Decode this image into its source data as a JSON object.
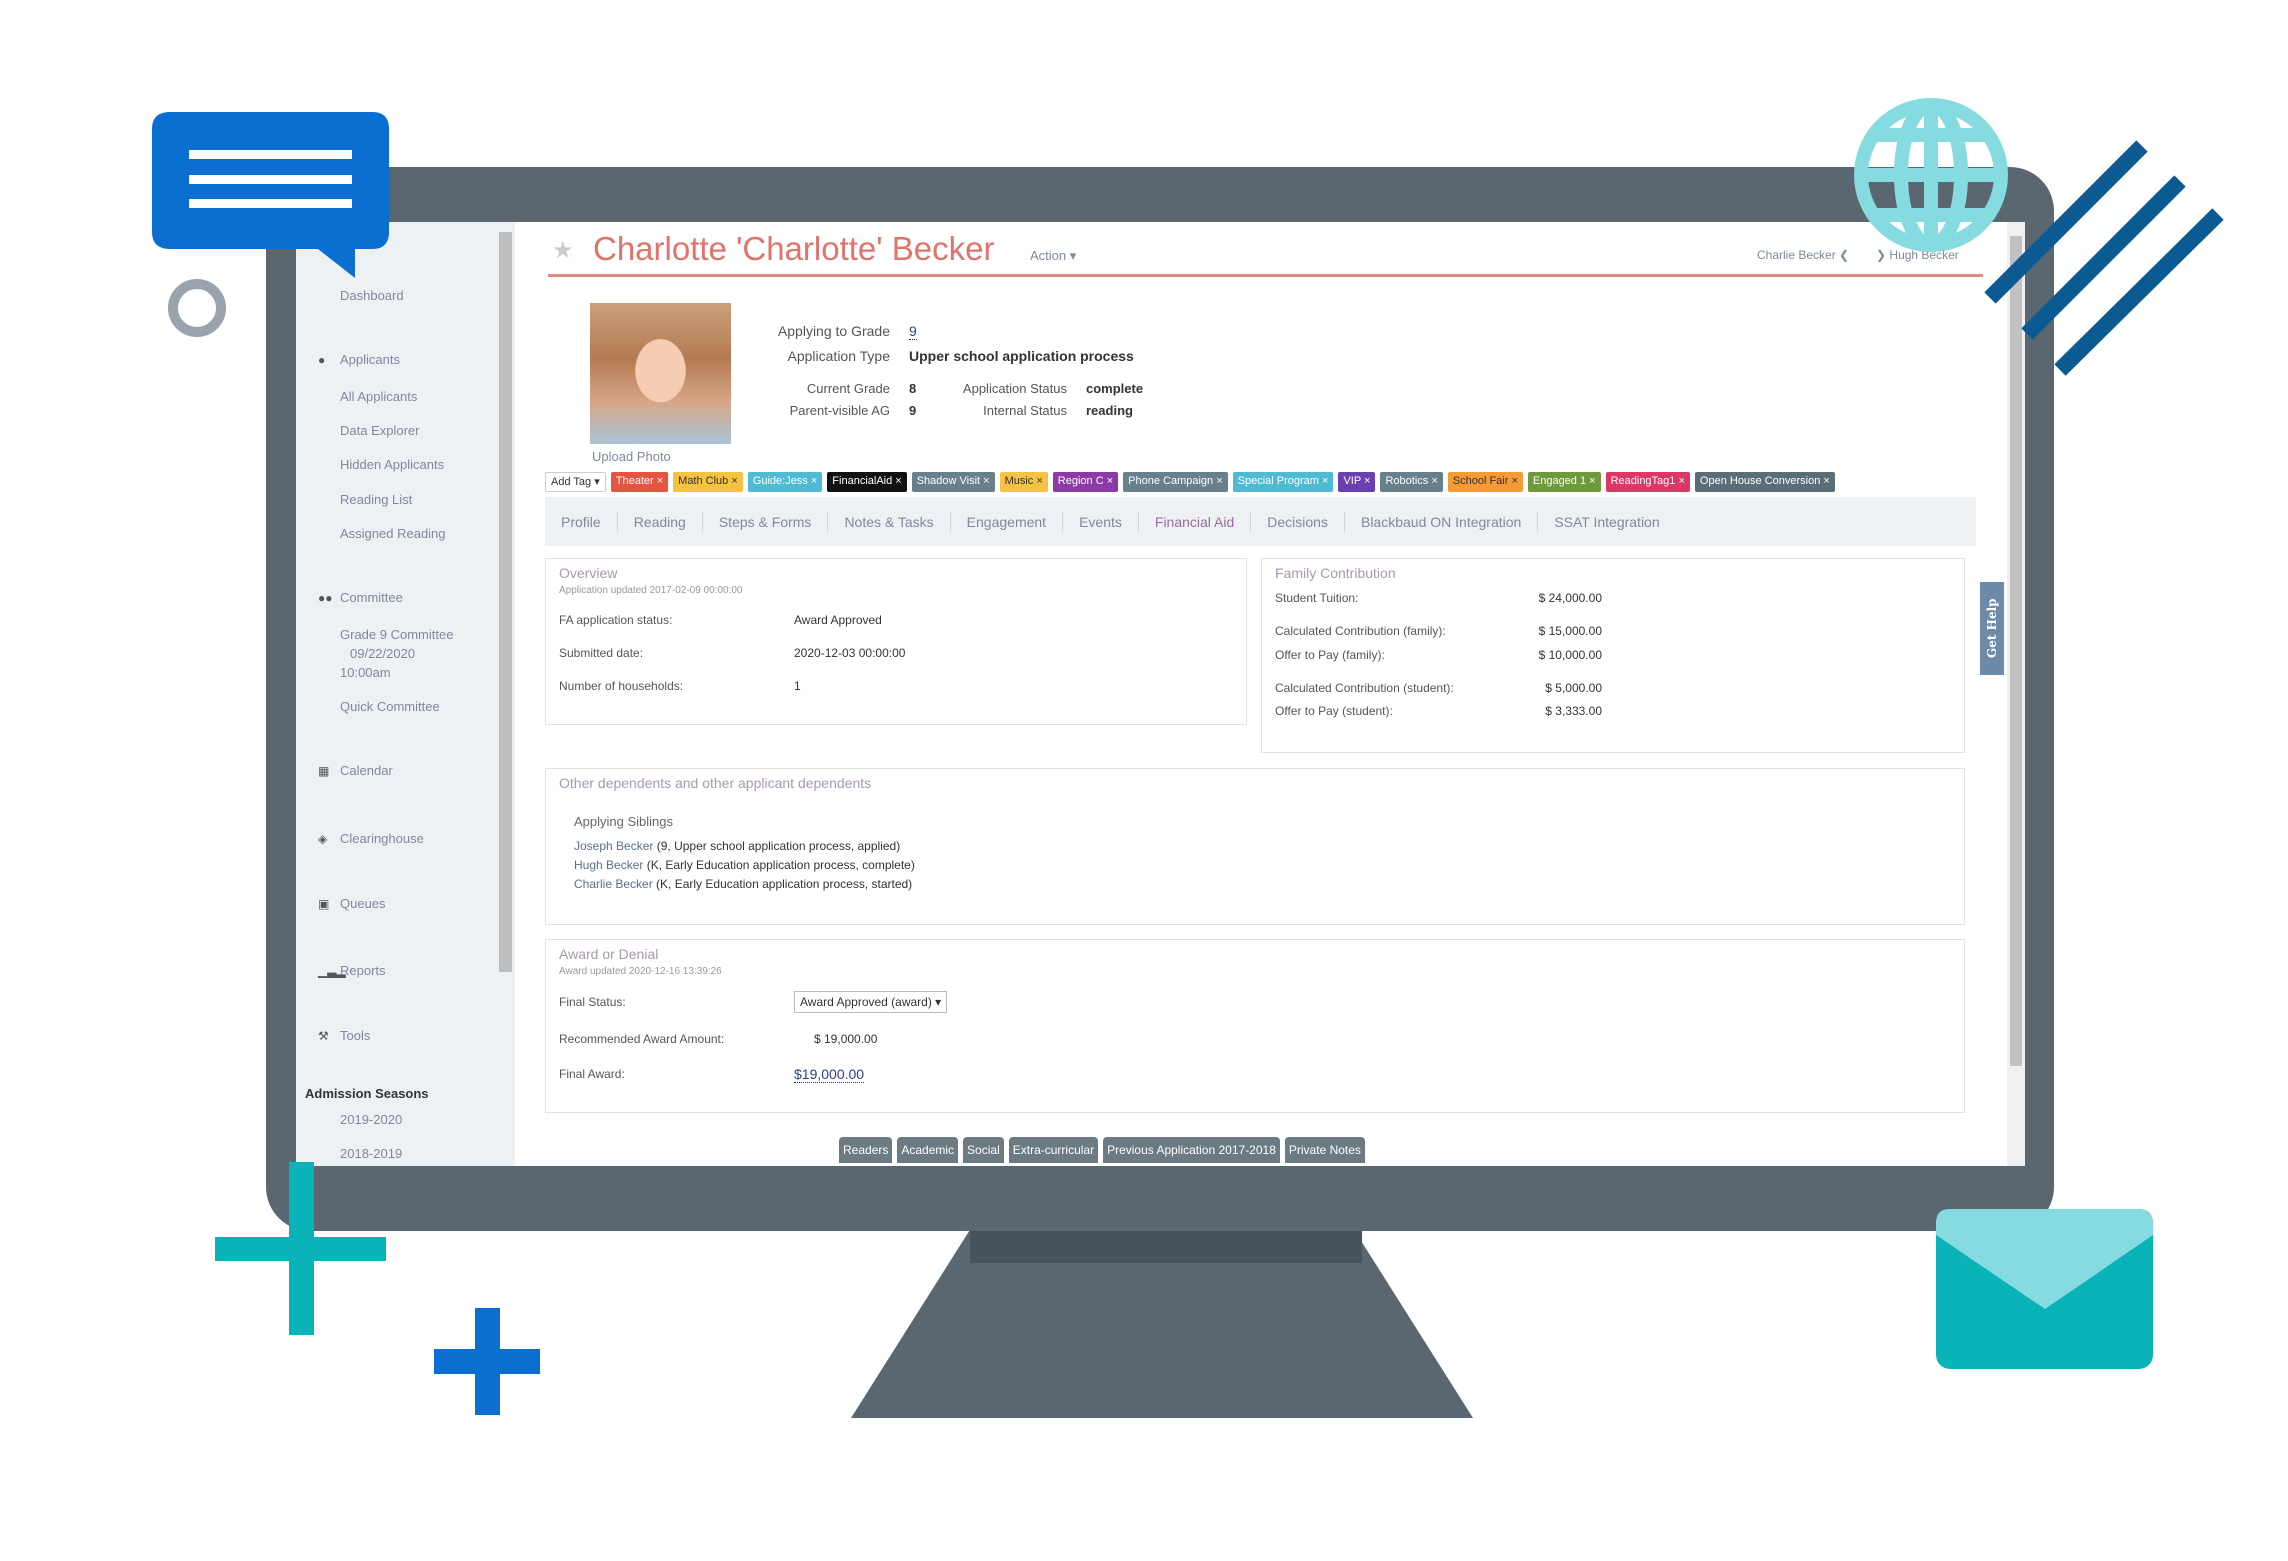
{
  "header": {
    "applicant_name": "Charlotte 'Charlotte' Becker",
    "action_label": "Action ▾",
    "prev_applicant": "Charlie Becker",
    "next_applicant": "Hugh Becker",
    "upload_photo": "Upload Photo"
  },
  "summary": {
    "applying_grade_label": "Applying to Grade",
    "applying_grade": "9",
    "app_type_label": "Application Type",
    "app_type": "Upper school application process",
    "current_grade_label": "Current Grade",
    "current_grade": "8",
    "parent_ag_label": "Parent-visible AG",
    "parent_ag": "9",
    "app_status_label": "Application Status",
    "app_status": "complete",
    "internal_status_label": "Internal Status",
    "internal_status": "reading"
  },
  "add_tag_label": "Add Tag ▾",
  "tags": [
    {
      "label": "Theater",
      "color": "#e45541",
      "text": "#fff"
    },
    {
      "label": "Math Club",
      "color": "#f5c242",
      "text": "#333"
    },
    {
      "label": "Guide:Jess",
      "color": "#4fbad3",
      "text": "#fff"
    },
    {
      "label": "FinancialAid",
      "color": "#111111",
      "text": "#fff"
    },
    {
      "label": "Shadow Visit",
      "color": "#67808c",
      "text": "#fff"
    },
    {
      "label": "Music",
      "color": "#f5c242",
      "text": "#333"
    },
    {
      "label": "Region C",
      "color": "#8e3aa6",
      "text": "#fff"
    },
    {
      "label": "Phone Campaign",
      "color": "#67808c",
      "text": "#fff"
    },
    {
      "label": "Special Program",
      "color": "#4fbad3",
      "text": "#fff"
    },
    {
      "label": "VIP",
      "color": "#6a3fb0",
      "text": "#fff"
    },
    {
      "label": "Robotics",
      "color": "#67808c",
      "text": "#fff"
    },
    {
      "label": "School Fair",
      "color": "#f59a36",
      "text": "#333"
    },
    {
      "label": "Engaged 1",
      "color": "#6d9a3b",
      "text": "#fff"
    },
    {
      "label": "ReadingTag1",
      "color": "#dd3766",
      "text": "#fff"
    },
    {
      "label": "Open House Conversion",
      "color": "#5a6e78",
      "text": "#fff"
    }
  ],
  "tabs": [
    "Profile",
    "Reading",
    "Steps & Forms",
    "Notes & Tasks",
    "Engagement",
    "Events",
    "Financial Aid",
    "Decisions",
    "Blackbaud ON Integration",
    "SSAT Integration"
  ],
  "active_tab": "Financial Aid",
  "sidebar": {
    "dashboard": "Dashboard",
    "applicants": "Applicants",
    "applicants_items": [
      "All Applicants",
      "Data Explorer",
      "Hidden Applicants",
      "Reading List",
      "Assigned Reading"
    ],
    "committee": "Committee",
    "committee_items": [
      "Grade 9 Committee",
      "09/22/2020",
      "10:00am",
      "Quick Committee"
    ],
    "calendar": "Calendar",
    "clearinghouse": "Clearinghouse",
    "queues": "Queues",
    "reports": "Reports",
    "tools": "Tools",
    "seasons_heading": "Admission Seasons",
    "seasons": [
      "2019-2020",
      "2018-2019"
    ]
  },
  "overview": {
    "title": "Overview",
    "updated": "Application updated 2017-02-09 00:00:00",
    "rows": [
      {
        "label": "FA application status:",
        "value": "Award Approved"
      },
      {
        "label": "Submitted date:",
        "value": "2020-12-03 00:00:00"
      },
      {
        "label": "Number of households:",
        "value": "1"
      }
    ]
  },
  "family": {
    "title": "Family Contribution",
    "rows": [
      {
        "label": "Student Tuition:",
        "value": "$ 24,000.00"
      },
      {
        "label": "Calculated Contribution (family):",
        "value": "$ 15,000.00"
      },
      {
        "label": "Offer to Pay (family):",
        "value": "$ 10,000.00"
      },
      {
        "label": "Calculated Contribution (student):",
        "value": "$ 5,000.00"
      },
      {
        "label": "Offer to Pay (student):",
        "value": "$ 3,333.00"
      }
    ]
  },
  "dependents": {
    "title": "Other dependents and other applicant dependents",
    "subtitle": "Applying Siblings",
    "siblings": [
      {
        "name": "Joseph Becker",
        "detail": "(9, Upper school application process, applied)"
      },
      {
        "name": "Hugh Becker",
        "detail": "(K, Early Education application process, complete)"
      },
      {
        "name": "Charlie Becker",
        "detail": "(K, Early Education application process, started)"
      }
    ]
  },
  "award": {
    "title": "Award or Denial",
    "updated": "Award updated 2020-12-16 13:39:26",
    "final_status_label": "Final Status:",
    "final_status": "Award Approved (award) ▾",
    "recommended_label": "Recommended Award Amount:",
    "recommended": "$ 19,000.00",
    "final_award_label": "Final Award:",
    "final_award": "$19,000.00"
  },
  "bottom_tabs": [
    "Readers",
    "Academic",
    "Social",
    "Extra-curricular",
    "Previous Application 2017-2018",
    "Private Notes"
  ],
  "get_help": "Get Help",
  "colors": {
    "accent": "#e0736c",
    "bezel": "#5b6770",
    "teal": "#0ab3b8",
    "blue": "#0a6fd0",
    "navy": "#0b5a91",
    "light_teal": "#86dbe0"
  }
}
